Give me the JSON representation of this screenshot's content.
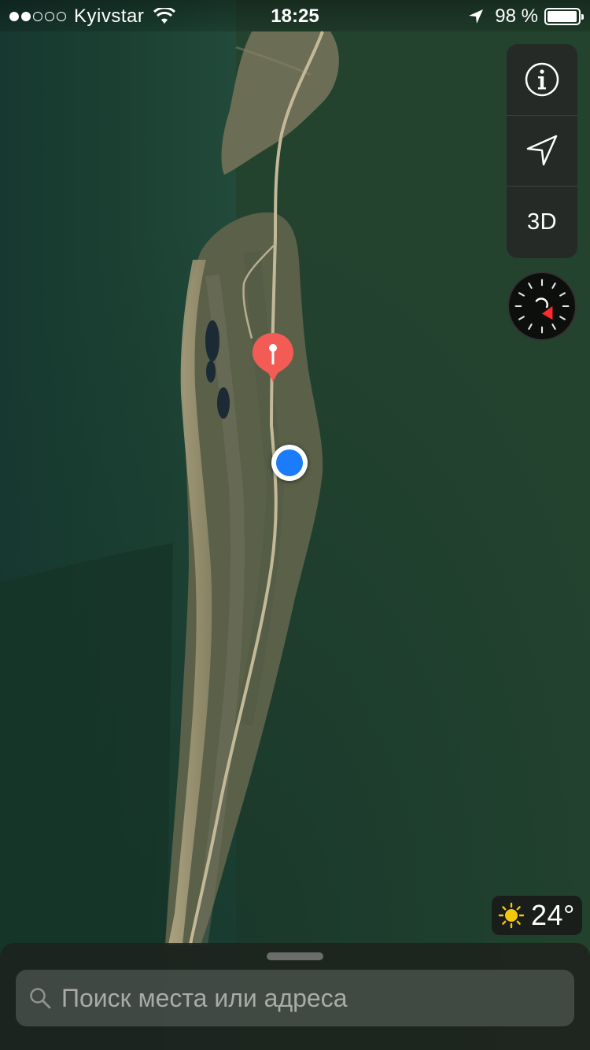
{
  "status_bar": {
    "carrier": "Kyivstar",
    "signal_filled": 2,
    "signal_total": 5,
    "time": "18:25",
    "battery": "98 %",
    "battery_level": 0.98
  },
  "map": {
    "type": "satellite",
    "controls": {
      "info_icon": "info-icon",
      "location_icon": "location-arrow-icon",
      "view_mode_label": "3D"
    },
    "compass_icon": "compass-icon",
    "dropped_pin_icon": "red-map-pin-icon",
    "user_location_icon": "blue-location-dot",
    "colors": {
      "pin": "#f25c54",
      "user_dot": "#1a7cfa",
      "water": "#1e3f33"
    }
  },
  "weather": {
    "icon": "sun-icon",
    "temperature": "24°"
  },
  "bottom_sheet": {
    "search": {
      "icon": "search-icon",
      "placeholder": "Поиск места или адреса"
    }
  }
}
